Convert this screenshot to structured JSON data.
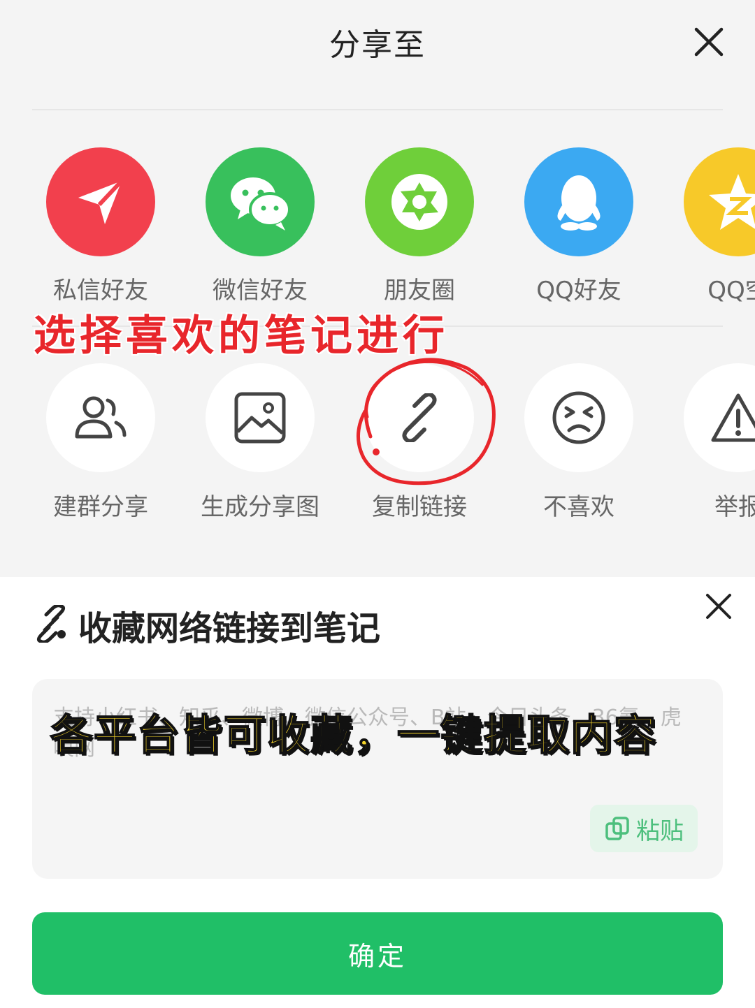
{
  "share_sheet": {
    "title": "分享至",
    "row1": [
      {
        "label": "私信好友",
        "icon": "paper-plane-icon",
        "color": "#f2404d"
      },
      {
        "label": "微信好友",
        "icon": "wechat-icon",
        "color": "#38c05c"
      },
      {
        "label": "朋友圈",
        "icon": "moments-aperture-icon",
        "color": "#6fcf3a"
      },
      {
        "label": "QQ好友",
        "icon": "qq-penguin-icon",
        "color": "#3ba9f2"
      },
      {
        "label": "QQ空",
        "icon": "qzone-star-icon",
        "color": "#f7c929"
      }
    ],
    "row2": [
      {
        "label": "建群分享",
        "icon": "group-users-icon"
      },
      {
        "label": "生成分享图",
        "icon": "image-icon"
      },
      {
        "label": "复制链接",
        "icon": "link-icon"
      },
      {
        "label": "不喜欢",
        "icon": "unhappy-face-icon"
      },
      {
        "label": "举报",
        "icon": "warning-icon"
      }
    ]
  },
  "annotations": {
    "red_caption": "选择喜欢的笔记进行",
    "yellow_caption": "各平台皆可收藏，一键提取内容"
  },
  "bottom_panel": {
    "title": "收藏网络链接到笔记",
    "textarea_placeholder": "支持小红书、知乎、微博、微信公众号、B站、今日头条、36氪、虎嗅网",
    "paste_label": "粘贴",
    "confirm_label": "确定"
  },
  "colors": {
    "accent_green": "#20bf67",
    "annotation_red": "#e8262b",
    "annotation_yellow": "#f5d42a"
  }
}
